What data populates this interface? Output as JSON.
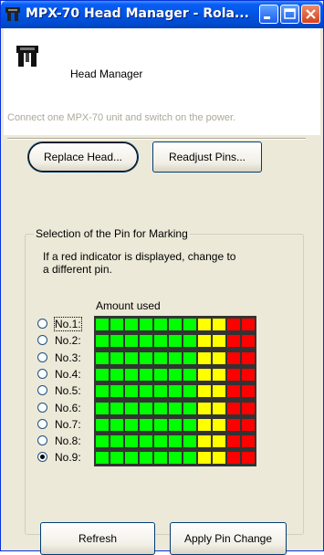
{
  "window": {
    "title": "MPX-70 Head Manager - Rola...",
    "minimize_icon": "minimize-icon",
    "maximize_icon": "maximize-icon",
    "close_icon": "close-icon",
    "titlebar_color": "#0054e3"
  },
  "header": {
    "app_icon": "print-head-icon",
    "label": "Head Manager",
    "hint": "Connect one MPX-70 unit and switch on the power."
  },
  "actions": {
    "replace_head": "Replace Head...",
    "readjust_pins": "Readjust Pins..."
  },
  "pin_selection": {
    "group_title": "Selection of the Pin for Marking",
    "instruction_line1": "If a red indicator is displayed, change to",
    "instruction_line2": "a different pin.",
    "amount_label": "Amount used",
    "selected_pin": "No.9:",
    "pins": [
      {
        "label": "No.1:",
        "selected": false,
        "focused": true
      },
      {
        "label": "No.2:",
        "selected": false,
        "focused": false
      },
      {
        "label": "No.3:",
        "selected": false,
        "focused": false
      },
      {
        "label": "No.4:",
        "selected": false,
        "focused": false
      },
      {
        "label": "No.5:",
        "selected": false,
        "focused": false
      },
      {
        "label": "No.6:",
        "selected": false,
        "focused": false
      },
      {
        "label": "No.7:",
        "selected": false,
        "focused": false
      },
      {
        "label": "No.8:",
        "selected": false,
        "focused": false
      },
      {
        "label": "No.9:",
        "selected": true,
        "focused": false
      }
    ],
    "meter_segments": [
      "green",
      "green",
      "green",
      "green",
      "green",
      "green",
      "green",
      "yellow",
      "yellow",
      "red",
      "red"
    ],
    "meter_colors": {
      "green": "#00ff00",
      "yellow": "#ffff00",
      "red": "#ff0000",
      "background": "#333333"
    }
  },
  "footer": {
    "refresh": "Refresh",
    "apply_pin_change": "Apply Pin Change"
  }
}
